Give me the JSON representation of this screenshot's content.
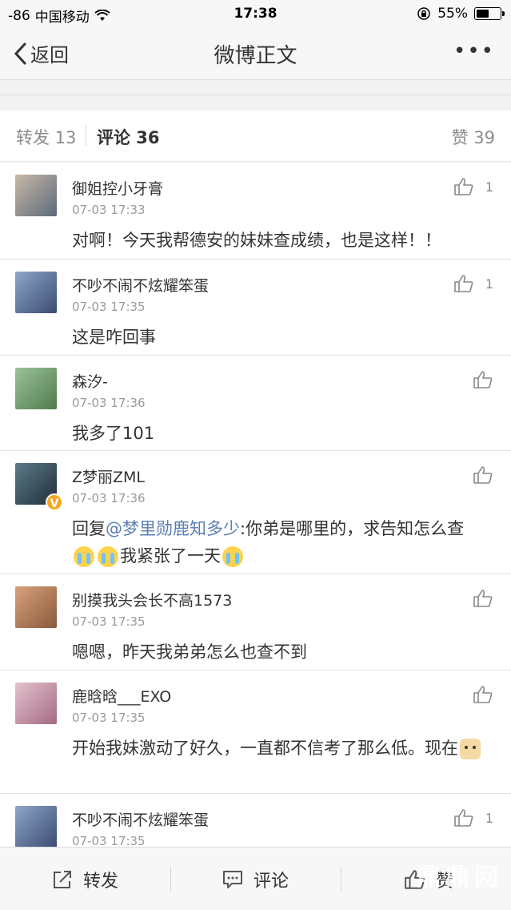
{
  "status_bar": {
    "signal": "-86",
    "carrier": "中国移动",
    "time": "17:38",
    "battery": "55%",
    "battery_level": 0.55
  },
  "nav": {
    "back_label": "返回",
    "title": "微博正文"
  },
  "tabs": {
    "repost": "转发 13",
    "comment": "评论 36",
    "like": "赞 39"
  },
  "comments": [
    {
      "username": "御姐控小牙膏",
      "time": "07-03 17:33",
      "text": "对啊！今天我帮德安的妹妹查成绩，也是这样！！",
      "likes": "1",
      "avatar_colors": [
        "#c9b8a8",
        "#5b6b7a"
      ]
    },
    {
      "username": "不吵不闹不炫耀笨蛋",
      "time": "07-03 17:35",
      "text": "这是咋回事",
      "likes": "1",
      "avatar_colors": [
        "#8ea7c8",
        "#3b4b72"
      ]
    },
    {
      "username": "森汐-",
      "time": "07-03 17:36",
      "text": "我多了101",
      "likes": "",
      "avatar_colors": [
        "#9cc39a",
        "#4f7a4d"
      ]
    },
    {
      "username": "Z梦丽ZML",
      "time": "07-03 17:36",
      "text_parts": {
        "prefix": "回复",
        "mention": "@梦里勋鹿知多少",
        "body": ":你弟是哪里的，求告知怎么查",
        "suffix": "我紧张了一天"
      },
      "likes": "",
      "verified": "V",
      "avatar_colors": [
        "#5d7a88",
        "#1f2f3a"
      ]
    },
    {
      "username": "别摸我头会长不高1573",
      "time": "07-03 17:35",
      "text": "嗯嗯，昨天我弟弟怎么也查不到",
      "likes": "",
      "avatar_colors": [
        "#d8a27c",
        "#8a5a3c"
      ]
    },
    {
      "username": "鹿晗晗___EXO",
      "time": "07-03 17:35",
      "text": "开始我妹激动了好久，一直都不信考了那么低。现在",
      "likes": "",
      "avatar_colors": [
        "#e6c2cf",
        "#a36a82"
      ]
    },
    {
      "username": "不吵不闹不炫耀笨蛋",
      "time": "07-03 17:35",
      "text": "",
      "likes": "1",
      "avatar_colors": [
        "#8ea7c8",
        "#3b4b72"
      ]
    }
  ],
  "toolbar": {
    "repost": "转发",
    "comment": "评论",
    "like": "赞"
  },
  "watermark": "鼎鼎网"
}
